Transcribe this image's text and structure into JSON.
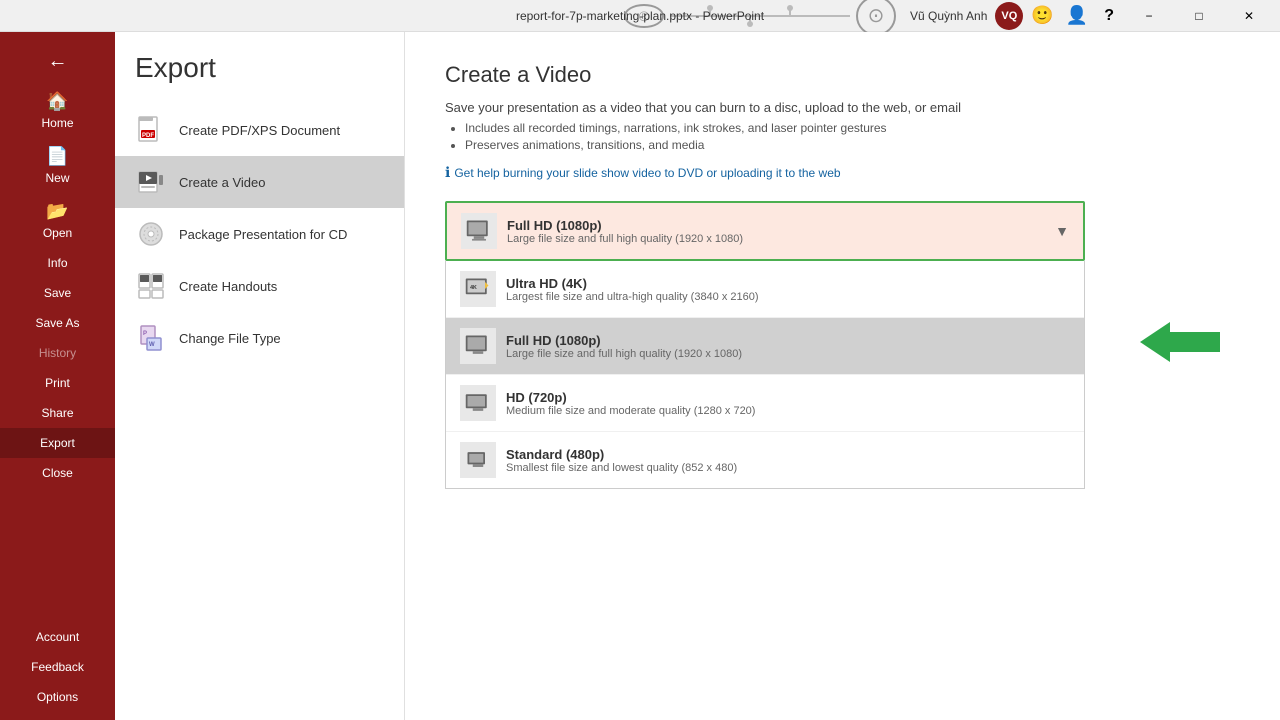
{
  "titlebar": {
    "filename": "report-for-7p-marketing-plan.pptx",
    "app": "PowerPoint",
    "title_text": "report-for-7p-marketing-plan.pptx  -  PowerPoint",
    "user_name": "Vũ Quỳnh Anh",
    "user_initials": "VQ"
  },
  "sidebar": {
    "back_icon": "←",
    "items": [
      {
        "id": "home",
        "label": "Home",
        "icon": "🏠"
      },
      {
        "id": "new",
        "label": "New",
        "icon": "📄"
      },
      {
        "id": "open",
        "label": "Open",
        "icon": "📂"
      },
      {
        "id": "info",
        "label": "Info",
        "icon": ""
      },
      {
        "id": "save",
        "label": "Save",
        "icon": ""
      },
      {
        "id": "save-as",
        "label": "Save As",
        "icon": ""
      },
      {
        "id": "history",
        "label": "History",
        "icon": ""
      },
      {
        "id": "print",
        "label": "Print",
        "icon": ""
      },
      {
        "id": "share",
        "label": "Share",
        "icon": ""
      },
      {
        "id": "export",
        "label": "Export",
        "icon": "",
        "active": true
      },
      {
        "id": "close",
        "label": "Close",
        "icon": ""
      }
    ],
    "bottom_items": [
      {
        "id": "account",
        "label": "Account"
      },
      {
        "id": "feedback",
        "label": "Feedback"
      },
      {
        "id": "options",
        "label": "Options"
      }
    ]
  },
  "export": {
    "page_title": "Export",
    "nav_items": [
      {
        "id": "create-pdf",
        "label": "Create PDF/XPS Document"
      },
      {
        "id": "create-video",
        "label": "Create a Video",
        "active": true
      },
      {
        "id": "package-presentation",
        "label": "Package Presentation for CD"
      },
      {
        "id": "create-handouts",
        "label": "Create Handouts"
      },
      {
        "id": "change-file-type",
        "label": "Change File Type"
      }
    ],
    "section_title": "Create a Video",
    "description": "Save your presentation as a video that you can burn to a disc, upload to the web, or email",
    "bullets": [
      "Includes all recorded timings, narrations, ink strokes, and laser pointer gestures",
      "Preserves animations, transitions, and media"
    ],
    "help_link": "Get help burning your slide show video to DVD or uploading it to the web",
    "dropdown": {
      "selected": {
        "title": "Full HD (1080p)",
        "subtitle": "Large file size and full high quality (1920 x 1080)"
      },
      "options": [
        {
          "id": "ultra-hd",
          "title": "Ultra HD (4K)",
          "subtitle": "Largest file size and ultra-high quality (3840 x 2160)"
        },
        {
          "id": "full-hd",
          "title": "Full HD (1080p)",
          "subtitle": "Large file size and full high quality (1920 x 1080)",
          "highlighted": true
        },
        {
          "id": "hd",
          "title": "HD (720p)",
          "subtitle": "Medium file size and moderate quality (1280 x 720)"
        },
        {
          "id": "standard",
          "title": "Standard (480p)",
          "subtitle": "Smallest file size and lowest quality (852 x 480)"
        }
      ]
    }
  }
}
